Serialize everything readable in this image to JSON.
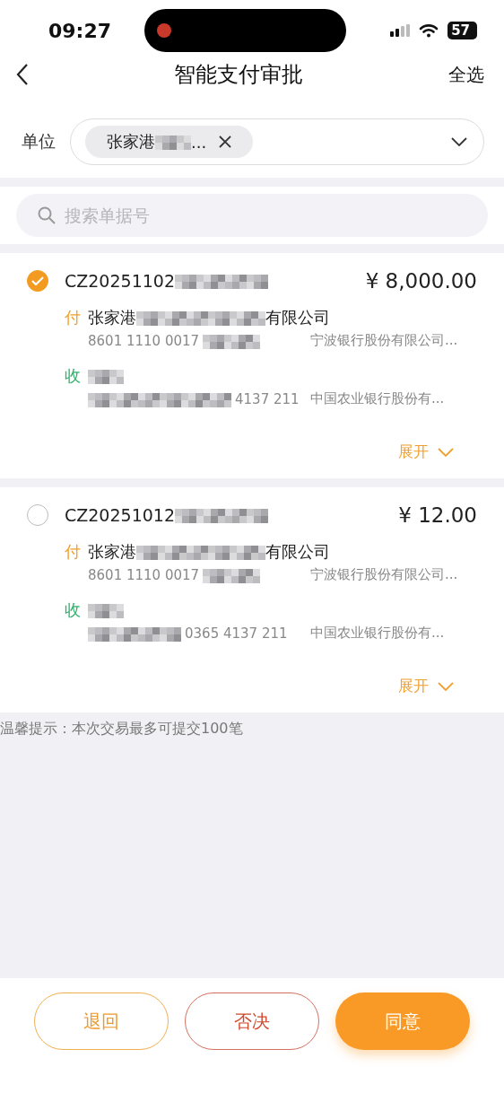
{
  "status_bar": {
    "time": "09:27",
    "battery": "57"
  },
  "header": {
    "title": "智能支付审批",
    "action": "全选"
  },
  "unit_filter": {
    "label": "单位",
    "chip": [
      {
        "kind": "text",
        "text": "张家港"
      },
      {
        "kind": "mosaic"
      },
      {
        "kind": "text",
        "text": "..."
      }
    ]
  },
  "search": {
    "placeholder": "搜索单据号"
  },
  "payments": [
    {
      "selected": true,
      "number": [
        {
          "kind": "text",
          "text": "CZ20251102"
        },
        {
          "kind": "mosaic"
        }
      ],
      "amount": "¥ 8,000.00",
      "payer_label": "付",
      "payer": [
        {
          "kind": "text",
          "text": "张家港"
        },
        {
          "kind": "mosaic"
        },
        {
          "kind": "text",
          "text": "有限公司"
        }
      ],
      "payer_account": [
        {
          "kind": "text",
          "text": "8601 1110 0017"
        },
        {
          "kind": "mosaic"
        }
      ],
      "payer_bank": "宁波银行股份有限公司...",
      "payee_label": "收",
      "payee": [
        {
          "kind": "mosaic"
        }
      ],
      "payee_account": [
        {
          "kind": "mosaic"
        },
        {
          "kind": "text",
          "text": "4137 211"
        }
      ],
      "payee_bank": "中国农业银行股份有...",
      "expand": "展开"
    },
    {
      "selected": false,
      "number": [
        {
          "kind": "text",
          "text": "CZ20251012"
        },
        {
          "kind": "mosaic"
        }
      ],
      "amount": "¥ 12.00",
      "payer_label": "付",
      "payer": [
        {
          "kind": "text",
          "text": "张家港"
        },
        {
          "kind": "mosaic"
        },
        {
          "kind": "text",
          "text": "有限公司"
        }
      ],
      "payer_account": [
        {
          "kind": "text",
          "text": "8601 1110 0017"
        },
        {
          "kind": "mosaic"
        }
      ],
      "payer_bank": "宁波银行股份有限公司...",
      "payee_label": "收",
      "payee": [
        {
          "kind": "mosaic"
        }
      ],
      "payee_account": [
        {
          "kind": "mosaic"
        },
        {
          "kind": "text",
          "text": "0365 4137 211"
        }
      ],
      "payee_bank": "中国农业银行股份有...",
      "expand": "展开"
    }
  ],
  "tip": "温馨提示：本次交易最多可提交100笔",
  "buttons": [
    {
      "kind": "return",
      "label": "退回"
    },
    {
      "kind": "reject",
      "label": "否决"
    },
    {
      "kind": "approve",
      "label": "同意"
    }
  ]
}
